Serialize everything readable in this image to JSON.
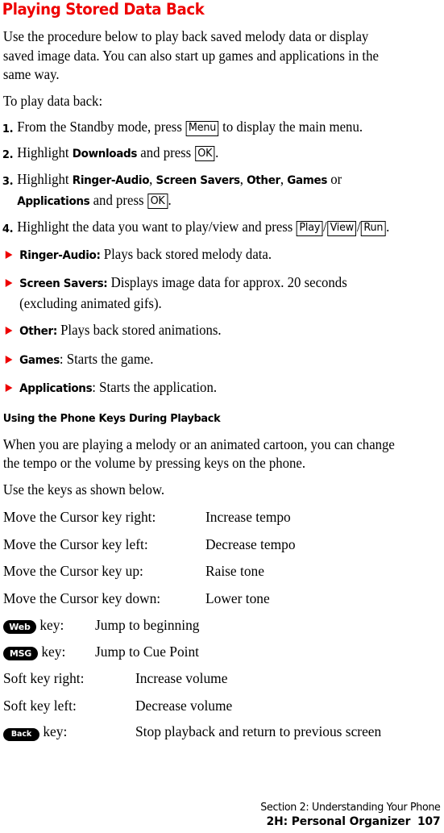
{
  "page": {
    "title": "Playing Stored Data Back",
    "title_color": "#ee0000",
    "bullet_color": "#ee0000",
    "intro": "Use the procedure below to play back saved melody data or display saved image data. You can also start up games and applications in the same way.",
    "lead_in": "To play data back:"
  },
  "steps": [
    {
      "number": "1",
      "dot": ".",
      "pre": "From the Standby mode, press",
      "key": "Menu",
      "post": "to display the main menu."
    },
    {
      "number": "2",
      "dot": ".",
      "pre": "Highlight",
      "bold": "Downloads",
      "mid": "and press",
      "key": "OK",
      "post": "."
    },
    {
      "number": "3",
      "dot": ".",
      "pre": "Highlight",
      "bold1": "Ringer-Audio",
      "sep1": ",",
      "bold2": "Screen Savers",
      "sep2": ",",
      "bold3": "Other",
      "sep3": ",",
      "bold4": "Games",
      "conj": "or",
      "bold5": "Applications",
      "mid": "and press",
      "key": "OK",
      "post": "."
    },
    {
      "number": "4",
      "dot": ".",
      "pre": "Highlight the data you want to play/view and press",
      "key1": "Play",
      "slash1": "/",
      "key2": "View",
      "slash2": "/",
      "key3": "Run",
      "post": "."
    }
  ],
  "bullets": [
    {
      "term": "Ringer-Audio:",
      "text": " Plays back stored melody data."
    },
    {
      "term": "Screen Savers:",
      "text": " Displays image data for approx. 20 seconds (excluding animated gifs)."
    },
    {
      "term": "Other:",
      "text": " Plays back stored animations."
    },
    {
      "term": "Games",
      "text": ": Starts the game."
    },
    {
      "term": "Applications",
      "text": ": Starts the application."
    }
  ],
  "subsection": {
    "heading": "Using the Phone Keys During Playback",
    "para1": "When you are playing a melody or an animated cartoon, you can change the tempo or the volume by pressing keys on the phone.",
    "para2": "Use the keys as shown below."
  },
  "key_table": {
    "cursor_rows": [
      {
        "key": "Move the Cursor key right:",
        "action": "Increase tempo"
      },
      {
        "key": "Move the Cursor key left:",
        "action": "Decrease tempo"
      },
      {
        "key": "Move the Cursor key up:",
        "action": "Raise tone"
      },
      {
        "key": "Move the Cursor key down:",
        "action": "Lower tone"
      }
    ],
    "pill_rows": [
      {
        "pill": "Web",
        "suffix": " key:",
        "action": "Jump to beginning"
      },
      {
        "pill": "MSG",
        "suffix": " key:",
        "action": "Jump to Cue Point"
      }
    ],
    "soft_rows": [
      {
        "key": "Soft key right:",
        "action": "Increase volume"
      },
      {
        "key": "Soft key left:",
        "action": "Decrease volume"
      }
    ],
    "back_row": {
      "pill": "Back",
      "suffix": " key:",
      "action": "Stop playback and return to previous screen"
    }
  },
  "footer": {
    "section": "Section 2: Understanding Your Phone",
    "chapter": "2H: Personal Organizer",
    "page_number": "107"
  }
}
